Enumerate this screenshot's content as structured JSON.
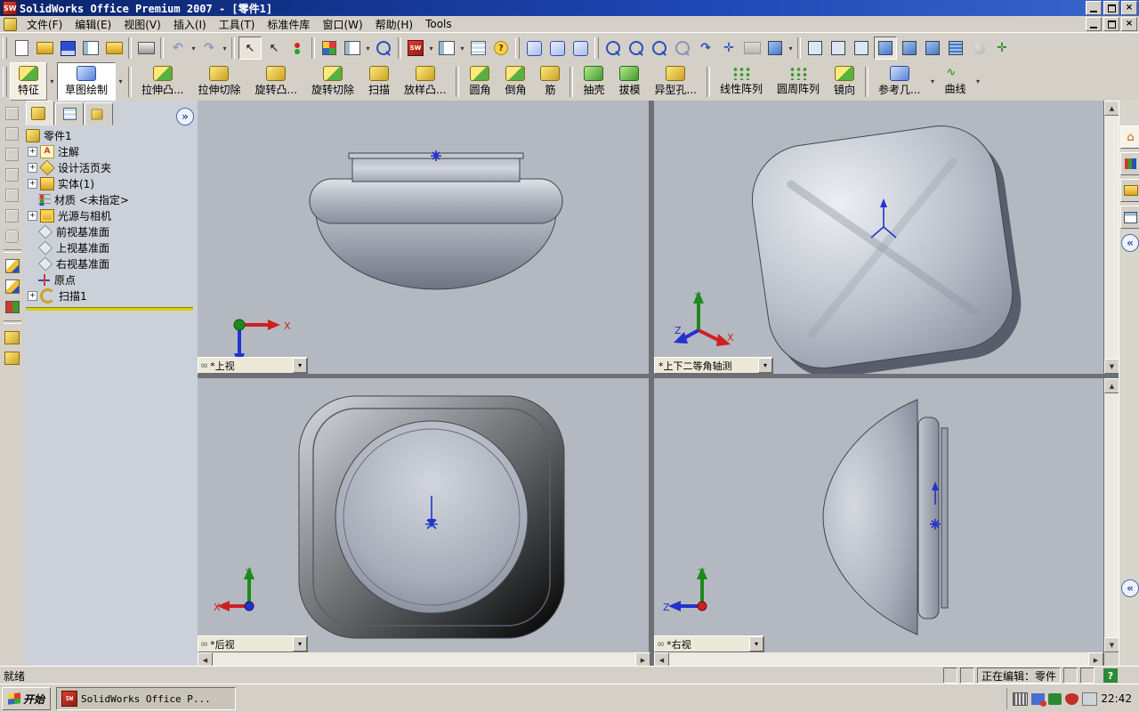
{
  "titlebar": {
    "title": "SolidWorks Office Premium 2007 - [零件1]"
  },
  "menubar": {
    "items": [
      "文件(F)",
      "编辑(E)",
      "视图(V)",
      "插入(I)",
      "工具(T)",
      "标准件库",
      "窗口(W)",
      "帮助(H)",
      "Tools"
    ]
  },
  "feature_toolbar": {
    "buttons": [
      "特征",
      "草图绘制",
      "拉伸凸...",
      "拉伸切除",
      "旋转凸...",
      "旋转切除",
      "扫描",
      "放样凸...",
      "圆角",
      "倒角",
      "筋",
      "抽壳",
      "拔模",
      "异型孔...",
      "线性阵列",
      "圆周阵列",
      "镜向",
      "参考几...",
      "曲线"
    ]
  },
  "feature_tree": {
    "root": "零件1",
    "items": [
      {
        "label": "注解"
      },
      {
        "label": "设计活页夹"
      },
      {
        "label": "实体(1)"
      },
      {
        "label": "材质 <未指定>"
      },
      {
        "label": "光源与相机"
      },
      {
        "label": "前视基准面"
      },
      {
        "label": "上视基准面"
      },
      {
        "label": "右视基准面"
      },
      {
        "label": "原点"
      },
      {
        "label": "扫描1"
      }
    ]
  },
  "viewports": {
    "top_left": {
      "label": "*上视"
    },
    "top_right": {
      "label": "*上下二等角轴测"
    },
    "bottom_left": {
      "label": "*后视"
    },
    "bottom_right": {
      "label": "*右视"
    }
  },
  "axis": {
    "x": "X",
    "y": "Y",
    "z": "Z"
  },
  "status_bar": {
    "ready": "就绪",
    "editing": "正在编辑：零件"
  },
  "taskbar": {
    "start": "开始",
    "active_task": "SolidWorks Office P...",
    "clock": "22:42"
  },
  "icons": {
    "sw_logo": "SW",
    "dropdown": "▾",
    "undo": "↶",
    "redo": "↷",
    "select": "↖",
    "help": "?",
    "question": "?",
    "chevron_right": "»",
    "chevron_left": "«",
    "link": "∞",
    "expand": "+",
    "close": "×",
    "up": "▲",
    "down": "▼",
    "left": "◀",
    "right": "▶",
    "home": "⌂",
    "annotation": "A",
    "move": "✛"
  },
  "colors": {
    "title_bar": "#0a246a",
    "chrome": "#d4d0c8",
    "viewport_bg": "#b4b8c0",
    "tree_bg": "#ccd0d8",
    "view_label_bg": "#ece9d8",
    "rollback_bar": "#d8ce00",
    "axis_x": "#cc2222",
    "axis_y": "#1c8a1c",
    "axis_z": "#2233cc"
  }
}
